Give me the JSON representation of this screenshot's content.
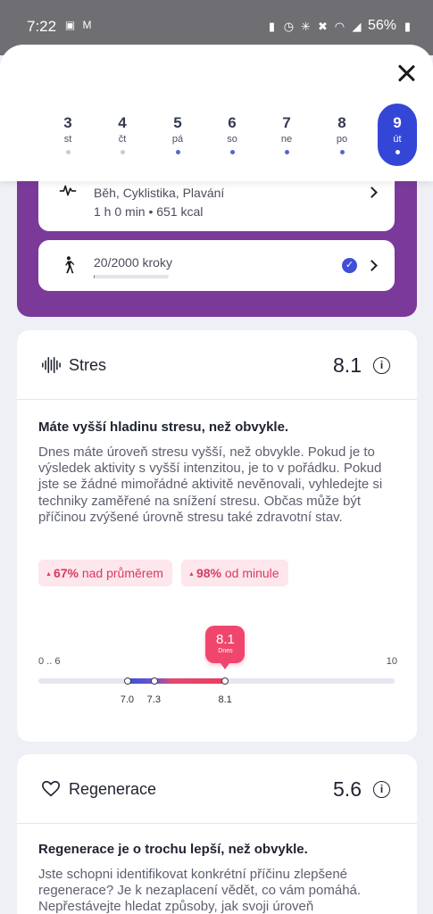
{
  "status_bar": {
    "time": "7:22",
    "battery": "56%",
    "left_icons": [
      "gallery-icon",
      "gmail-icon"
    ],
    "right_icons": [
      "lock-icon",
      "alarm-icon",
      "bluetooth-icon",
      "mute-icon",
      "wifi-icon",
      "signal-icon",
      "battery-icon"
    ]
  },
  "date_picker": {
    "days": [
      {
        "num": "3",
        "name": "st"
      },
      {
        "num": "4",
        "name": "čt"
      },
      {
        "num": "5",
        "name": "pá"
      },
      {
        "num": "6",
        "name": "so"
      },
      {
        "num": "7",
        "name": "ne"
      },
      {
        "num": "8",
        "name": "po"
      },
      {
        "num": "9",
        "name": "út"
      }
    ],
    "selected_index": 6
  },
  "activity": {
    "workouts": {
      "title": "Běh, Cyklistika, Plavání",
      "summary": "1 h 0 min • 651 kcal"
    },
    "steps": {
      "label": "20/2000 kroky",
      "progress_fraction": 0.01
    }
  },
  "stress": {
    "title": "Stres",
    "value": "8.1",
    "headline": "Máte vyšší hladinu stresu, než obvykle.",
    "body": "Dnes máte úroveň stresu vyšší, než obvykle. Pokud je to výsledek aktivity s vyšší intenzitou, je to v pořádku. Pokud jste se žádné mimořádné aktivitě nevěnovali, vyhledejte si techniky zaměřené na snížení stresu. Občas může být příčinou zvýšené úrovně stresu také zdravotní stav.",
    "chips": [
      {
        "pct": "67%",
        "text": "nad průměrem"
      },
      {
        "pct": "98%",
        "text": "od minule"
      }
    ],
    "scale": {
      "min_label": "0 .. 6",
      "max_label": "10",
      "points": [
        {
          "label": "7.0",
          "value": 7.0
        },
        {
          "label": "7.3",
          "value": 7.3
        },
        {
          "label": "8.1",
          "value": 8.1
        }
      ],
      "today_value": "8.1",
      "today_label": "Dnes"
    }
  },
  "regeneration": {
    "title": "Regenerace",
    "value": "5.6",
    "headline": "Regenerace je o trochu lepší, než obvykle.",
    "body": "Jste schopni identifikovat konkrétní příčinu zlepšené regenerace? Je k nezaplacení vědět, co vám pomáhá. Nepřestávejte hledat způsoby, jak svoji úroveň"
  },
  "colors": {
    "accent_blue": "#3446d6",
    "activity_purple": "#7b3a9a",
    "stress_pink": "#f0466d",
    "chip_bg": "#fde6ec"
  }
}
